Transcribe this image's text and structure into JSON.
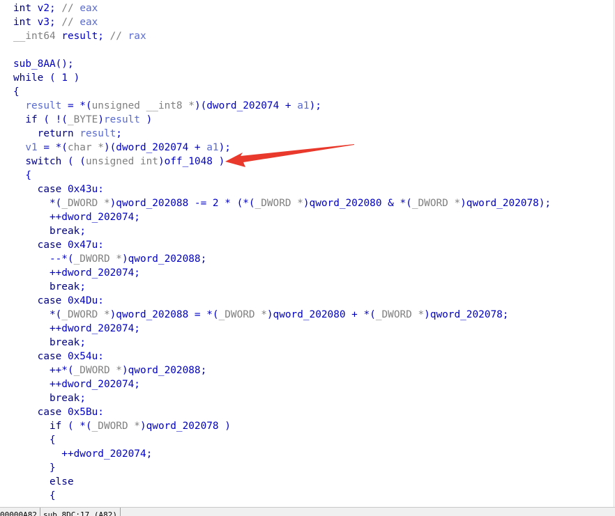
{
  "code_lines": [
    [
      [
        "k",
        "int"
      ],
      [
        "d",
        " v2; "
      ],
      [
        "g",
        "// "
      ],
      [
        "v",
        "eax"
      ]
    ],
    [
      [
        "k",
        "int"
      ],
      [
        "d",
        " v3; "
      ],
      [
        "g",
        "// "
      ],
      [
        "v",
        "eax"
      ]
    ],
    [
      [
        "g",
        "__int64"
      ],
      [
        "d",
        " result; "
      ],
      [
        "g",
        "// "
      ],
      [
        "v",
        "rax"
      ]
    ],
    [],
    [
      [
        "d",
        "sub_8AA();"
      ]
    ],
    [
      [
        "k",
        "while"
      ],
      [
        "d",
        " ( 1 )"
      ]
    ],
    [
      [
        "d",
        "{"
      ]
    ],
    [
      [
        "v",
        "  result"
      ],
      [
        "d",
        " = *("
      ],
      [
        "g",
        "unsigned __int8 *"
      ],
      [
        "d",
        ")(dword_202074 + "
      ],
      [
        "v",
        "a1"
      ],
      [
        "d",
        ");"
      ]
    ],
    [
      [
        "k",
        "  if"
      ],
      [
        "d",
        " ( !("
      ],
      [
        "g",
        "_BYTE"
      ],
      [
        "d",
        ")"
      ],
      [
        "v",
        "result"
      ],
      [
        "d",
        " )"
      ]
    ],
    [
      [
        "k",
        "    return "
      ],
      [
        "v",
        "result"
      ],
      [
        "d",
        ";"
      ]
    ],
    [
      [
        "v",
        "  v1"
      ],
      [
        "d",
        " = *("
      ],
      [
        "g",
        "char *"
      ],
      [
        "d",
        ")(dword_202074 + "
      ],
      [
        "v",
        "a1"
      ],
      [
        "d",
        ");"
      ]
    ],
    [
      [
        "k",
        "  switch"
      ],
      [
        "d",
        " ( ("
      ],
      [
        "g",
        "unsigned int"
      ],
      [
        "d",
        ")off_1048 )"
      ]
    ],
    [
      [
        "d",
        "  {"
      ]
    ],
    [
      [
        "k",
        "    case"
      ],
      [
        "d",
        " 0x43u:"
      ]
    ],
    [
      [
        "d",
        "      *("
      ],
      [
        "g",
        "_DWORD *"
      ],
      [
        "d",
        ")qword_202088 -= 2 * (*("
      ],
      [
        "g",
        "_DWORD *"
      ],
      [
        "d",
        ")qword_202080 & *("
      ],
      [
        "g",
        "_DWORD *"
      ],
      [
        "d",
        ")qword_202078);"
      ]
    ],
    [
      [
        "d",
        "      ++dword_202074;"
      ]
    ],
    [
      [
        "k",
        "      break"
      ],
      [
        "d",
        ";"
      ]
    ],
    [
      [
        "k",
        "    case"
      ],
      [
        "d",
        " 0x47u:"
      ]
    ],
    [
      [
        "d",
        "      --*("
      ],
      [
        "g",
        "_DWORD *"
      ],
      [
        "d",
        ")qword_202088;"
      ]
    ],
    [
      [
        "d",
        "      ++dword_202074;"
      ]
    ],
    [
      [
        "k",
        "      break"
      ],
      [
        "d",
        ";"
      ]
    ],
    [
      [
        "k",
        "    case"
      ],
      [
        "d",
        " 0x4Du:"
      ]
    ],
    [
      [
        "d",
        "      *("
      ],
      [
        "g",
        "_DWORD *"
      ],
      [
        "d",
        ")qword_202088 = *("
      ],
      [
        "g",
        "_DWORD *"
      ],
      [
        "d",
        ")qword_202080 + *("
      ],
      [
        "g",
        "_DWORD *"
      ],
      [
        "d",
        ")qword_202078;"
      ]
    ],
    [
      [
        "d",
        "      ++dword_202074;"
      ]
    ],
    [
      [
        "k",
        "      break"
      ],
      [
        "d",
        ";"
      ]
    ],
    [
      [
        "k",
        "    case"
      ],
      [
        "d",
        " 0x54u:"
      ]
    ],
    [
      [
        "d",
        "      ++*("
      ],
      [
        "g",
        "_DWORD *"
      ],
      [
        "d",
        ")qword_202088;"
      ]
    ],
    [
      [
        "d",
        "      ++dword_202074;"
      ]
    ],
    [
      [
        "k",
        "      break"
      ],
      [
        "d",
        ";"
      ]
    ],
    [
      [
        "k",
        "    case"
      ],
      [
        "d",
        " 0x5Bu:"
      ]
    ],
    [
      [
        "k",
        "      if"
      ],
      [
        "d",
        " ( *("
      ],
      [
        "g",
        "_DWORD *"
      ],
      [
        "d",
        ")qword_202078 )"
      ]
    ],
    [
      [
        "d",
        "      {"
      ]
    ],
    [
      [
        "d",
        "        ++dword_202074;"
      ]
    ],
    [
      [
        "d",
        "      }"
      ]
    ],
    [
      [
        "k",
        "      else"
      ]
    ],
    [
      [
        "d",
        "      {"
      ]
    ]
  ],
  "status_bar": {
    "address": "00000A82",
    "location": "sub_8DC:17 (A82)"
  },
  "annotation": {
    "arrow_color": "#e8392c"
  }
}
